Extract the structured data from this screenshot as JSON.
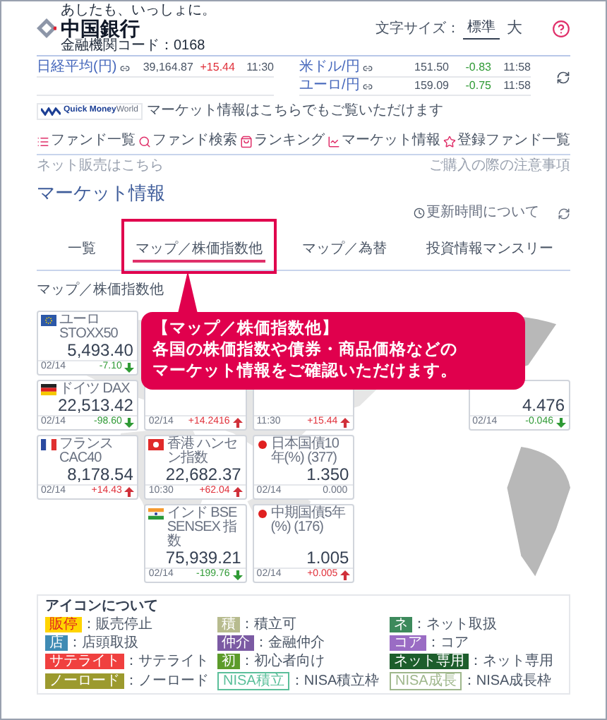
{
  "header": {
    "tagline": "あしたも、いっしょに。",
    "bank_name": "中国銀行",
    "code": "金融機関コード：0168",
    "font_size_label": "文字サイズ：",
    "font_sizes": [
      {
        "label": "標準",
        "selected": true
      },
      {
        "label": "大",
        "selected": false
      }
    ]
  },
  "ticker": {
    "left": [
      {
        "name": "日経平均(円)",
        "value": "39,164.87",
        "change": "+15.44",
        "time": "11:30",
        "color": "#e0303a"
      }
    ],
    "right": [
      {
        "name": "米ドル/円",
        "value": "151.50",
        "change": "-0.83",
        "time": "11:58",
        "color": "#2f9a35"
      },
      {
        "name": "ユーロ/円",
        "value": "159.09",
        "change": "-0.75",
        "time": "11:58",
        "color": "#2f9a35"
      }
    ],
    "quick": {
      "logo_bold": "Quick Money",
      "logo_light": "World",
      "notice": "マーケット情報はこちらでもご覧いただけます"
    }
  },
  "nav": [
    {
      "label": "ファンド一覧"
    },
    {
      "label": "ファンド検索"
    },
    {
      "label": "ランキング"
    },
    {
      "label": "マーケット情報"
    },
    {
      "label": "登録ファンド一覧"
    }
  ],
  "links": {
    "left": "ネット販売はこちら",
    "right": "ご購入の際の注意事項"
  },
  "page_title": "マーケット情報",
  "update_note": "更新時間について",
  "tabs": [
    {
      "label": "一覧",
      "selected": false,
      "highlighted": false
    },
    {
      "label": "マップ／株価指数他",
      "selected": true,
      "highlighted": true
    },
    {
      "label": "マップ／為替",
      "selected": false,
      "highlighted": false
    },
    {
      "label": "投資情報マンスリー",
      "selected": false,
      "highlighted": false
    }
  ],
  "section_title": "マップ／株価指数他",
  "map_rows": [
    [
      {
        "kind": "fall",
        "title": "ユーロSTOXX50",
        "value": "5,493.40",
        "date": "02/14",
        "change": "-7.10"
      },
      {
        "kind": "blank"
      },
      {
        "kind": "blank"
      },
      {
        "kind": "blank"
      },
      {
        "kind": "blank"
      }
    ],
    [
      {
        "kind": "fall",
        "title": "ドイツ DAX",
        "value": "22,513.42",
        "date": "02/14",
        "change": "-98.60"
      },
      {
        "kind": "rise",
        "date": "02/14",
        "change": "+14.2416"
      },
      {
        "kind": "rise",
        "date": "11:30",
        "change": "+15.44"
      },
      {
        "kind": "blank"
      },
      {
        "kind": "fall",
        "value": "4.476",
        "date": "02/14",
        "change": "-0.046"
      }
    ],
    [
      {
        "kind": "rise",
        "title": "フランス CAC40",
        "value": "8,178.54",
        "date": "02/14",
        "change": "+14.43"
      },
      {
        "kind": "rise",
        "title": "香港 ハンセン指数",
        "value": "22,682.37",
        "date": "10:30",
        "change": "+62.04"
      },
      {
        "kind": "flat",
        "title": "日本国債10年(%) (377)",
        "value": "1.350",
        "date": "02/14",
        "change": "0.000"
      },
      {
        "kind": "blank"
      },
      {
        "kind": "blank"
      }
    ],
    [
      {
        "kind": "blank"
      },
      {
        "kind": "fall",
        "title": "インド BSE SENSEX 指数",
        "value": "75,939.21",
        "date": "02/14",
        "change": "-199.76"
      },
      {
        "kind": "rise",
        "title": "中期国債5年(%) (176)",
        "value": "1.005",
        "date": "02/14",
        "change": "+0.005"
      },
      {
        "kind": "blank"
      },
      {
        "kind": "blank"
      }
    ]
  ],
  "callout": {
    "lines": [
      "【マップ／株価指数他】",
      "各国の株価指数や債券・商品価格などの",
      "マーケット情報をご確認いただけます。"
    ]
  },
  "legend": {
    "title": "アイコンについて",
    "items": [
      {
        "badge": "販停",
        "description": "：販売停止",
        "kind": "warning",
        "color": "#ffd400"
      },
      {
        "badge": "積",
        "description": "：積立可",
        "kind": "filled",
        "color": "#b7bb8e"
      },
      {
        "badge": "ネ",
        "description": "：ネット取扱",
        "kind": "filled",
        "color": "#3d8a5c"
      },
      {
        "badge": "店",
        "description": "：店頭取扱",
        "kind": "filled",
        "color": "#3f8bb4"
      },
      {
        "badge": "仲介",
        "description": "：金融仲介",
        "kind": "filled",
        "color": "#7b5aa3"
      },
      {
        "badge": "コア",
        "description": "：コア",
        "kind": "filled",
        "color": "#9a6cc4"
      },
      {
        "badge": "サテライト",
        "description": "：サテライト",
        "kind": "filled",
        "color": "#f0403f"
      },
      {
        "badge": "初",
        "description": "：初心者向け",
        "kind": "filled",
        "color": "#5c9b2a"
      },
      {
        "badge": "ネット専用",
        "description": "：ネット専用",
        "kind": "filled",
        "color": "#1d5e2c"
      },
      {
        "badge": "ノーロード",
        "description": "：ノーロード",
        "kind": "filled",
        "color": "#9c9a2e"
      },
      {
        "badge": "NISA積立",
        "description": "：NISA積立枠",
        "kind": "outline",
        "color": "#5bbf9a"
      },
      {
        "badge": "NISA成長",
        "description": "：NISA成長枠",
        "kind": "outline",
        "color": "#9fb78c"
      }
    ]
  }
}
